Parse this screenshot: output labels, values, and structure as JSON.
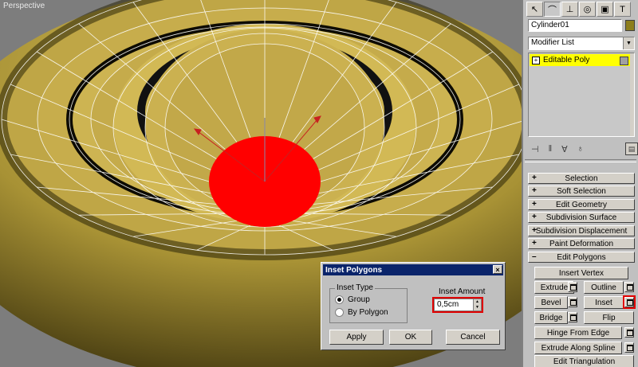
{
  "viewport": {
    "label": "Perspective"
  },
  "panel": {
    "tabs": [
      {
        "icon": "create-icon",
        "glyph": "↖"
      },
      {
        "icon": "modify-icon",
        "glyph": "⌒"
      },
      {
        "icon": "hierarchy-icon",
        "glyph": "⊥"
      },
      {
        "icon": "motion-icon",
        "glyph": "◎"
      },
      {
        "icon": "display-icon",
        "glyph": "▣"
      },
      {
        "icon": "utilities-icon",
        "glyph": "T"
      }
    ],
    "object_name": "Cylinder01",
    "object_color": "#8d7e1c",
    "modifier_list": "Modifier List",
    "stack_item": "Editable Poly",
    "stack_highlight": "#ffff00",
    "stack_tools": [
      "pin-stack-icon",
      "show-end-result-icon",
      "make-unique-icon",
      "remove-modifier-icon",
      "configure-sets-icon"
    ],
    "rollouts": [
      {
        "sign": "+",
        "label": "Selection"
      },
      {
        "sign": "+",
        "label": "Soft Selection"
      },
      {
        "sign": "+",
        "label": "Edit Geometry"
      },
      {
        "sign": "+",
        "label": "Subdivision Surface"
      },
      {
        "sign": "+",
        "label": "Subdivision Displacement"
      },
      {
        "sign": "+",
        "label": "Paint Deformation"
      },
      {
        "sign": "–",
        "label": "Edit Polygons"
      }
    ],
    "buttons": {
      "insert_vertex": "Insert Vertex",
      "extrude": "Extrude",
      "outline": "Outline",
      "bevel": "Bevel",
      "inset": "Inset",
      "bridge": "Bridge",
      "flip": "Flip",
      "hinge": "Hinge From Edge",
      "extrude_spline": "Extrude Along Spline",
      "edit_tri": "Edit Triangulation"
    }
  },
  "dialog": {
    "title": "Inset Polygons",
    "close": "×",
    "group_label": "Inset Type",
    "radio_group": "Group",
    "radio_polygon": "By Polygon",
    "selected": "Group",
    "amount_label": "Inset Amount",
    "amount_value": "0,5cm",
    "apply": "Apply",
    "ok": "OK",
    "cancel": "Cancel"
  },
  "colors": {
    "mesh": "#c9b04e",
    "selection": "#ff0000",
    "highlight_box": "#e00000",
    "titlebar": "#0a246a"
  }
}
